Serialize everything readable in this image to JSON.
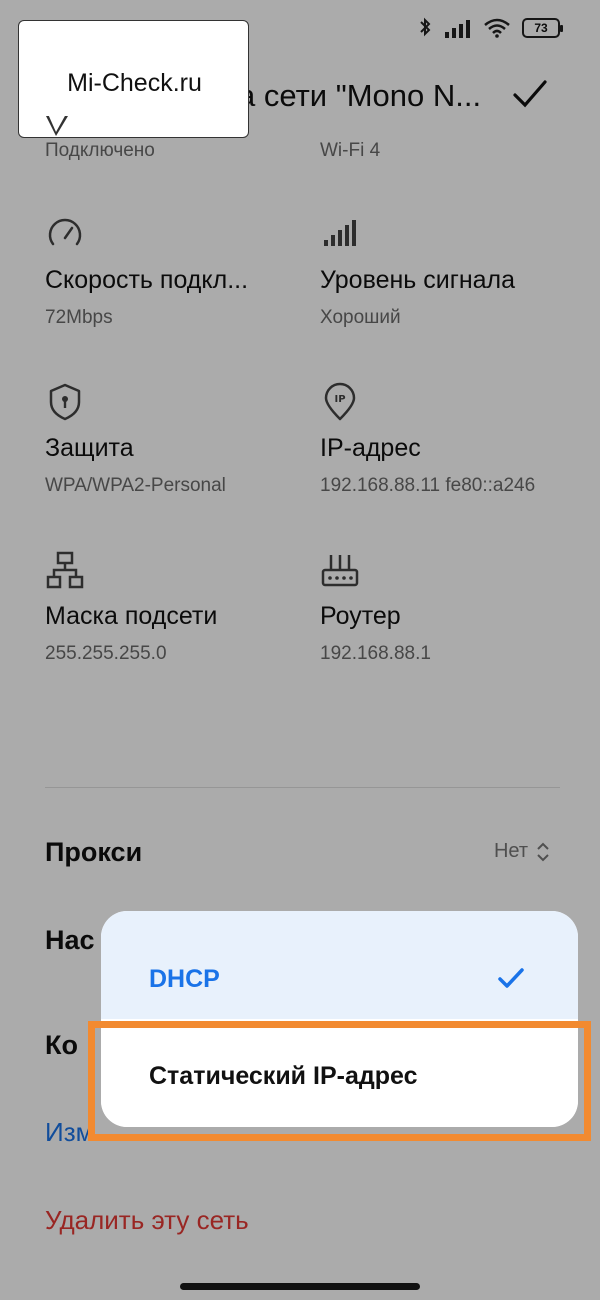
{
  "watermark": {
    "text": "Mi-Check.ru"
  },
  "status_bar": {
    "battery": "73"
  },
  "header": {
    "title": "а сети \"Mono N...",
    "confirm_icon": "checkmark-icon"
  },
  "info": {
    "status": {
      "value": "Подключено"
    },
    "standard": {
      "value": "Wi-Fi 4"
    },
    "speed": {
      "label": "Скорость подкл...",
      "value": "72Mbps",
      "icon": "speedometer-icon"
    },
    "signal": {
      "label": "Уровень сигнала",
      "value": "Хороший",
      "icon": "signal-bars-icon"
    },
    "security": {
      "label": "Защита",
      "value": "WPA/WPA2-Personal",
      "icon": "shield-icon"
    },
    "ip": {
      "label": "IP-адрес",
      "value": "192.168.88.11 fe80::a246",
      "icon": "ip-pin-icon"
    },
    "mask": {
      "label": "Маска подсети",
      "value": "255.255.255.0",
      "icon": "network-topology-icon"
    },
    "router": {
      "label": "Роутер",
      "value": "192.168.88.1",
      "icon": "router-icon"
    }
  },
  "proxy": {
    "label": "Прокси",
    "value": "Нет"
  },
  "rows": {
    "ip_settings_partial": "Нас",
    "config_partial": "Ко",
    "modify_partial": "Изм"
  },
  "delete_network": "Удалить эту сеть",
  "popup": {
    "options": [
      {
        "label": "DHCP",
        "selected": true
      },
      {
        "label": "Статический IP-адрес",
        "selected": false
      }
    ]
  },
  "colors": {
    "accent": "#1a73e8",
    "danger": "#e53935",
    "highlight": "#f28a30",
    "overlay": "rgba(0,0,0,0.33)"
  }
}
